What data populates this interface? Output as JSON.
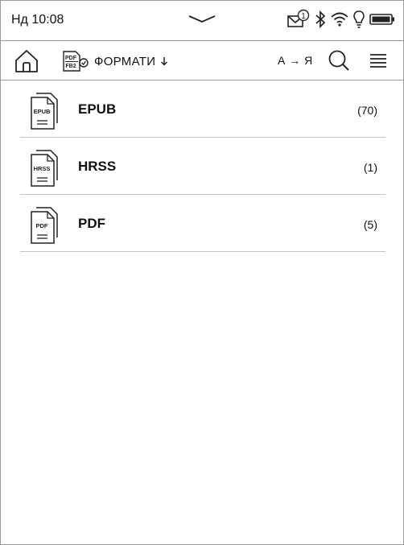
{
  "status": {
    "time": "Нд 10:08",
    "notification_count": "1"
  },
  "toolbar": {
    "formats_icon_top": "PDF",
    "formats_icon_bottom": "FB2",
    "formats_label": "ФОРМАТИ",
    "sort_label": "А → Я"
  },
  "formats": [
    {
      "name": "EPUB",
      "count": "(70)",
      "icon": "EPUB"
    },
    {
      "name": "HRSS",
      "count": "(1)",
      "icon": "HRSS"
    },
    {
      "name": "PDF",
      "count": "(5)",
      "icon": "PDF"
    }
  ]
}
